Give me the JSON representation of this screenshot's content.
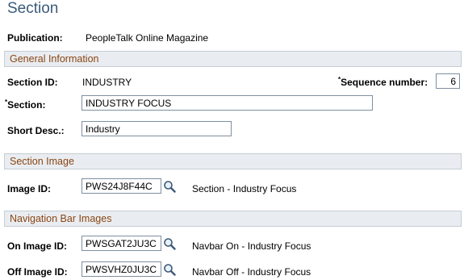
{
  "page": {
    "title": "Section"
  },
  "publication": {
    "label": "Publication:",
    "value": "PeopleTalk Online Magazine"
  },
  "general_info": {
    "header": "General Information",
    "section_id_label": "Section ID:",
    "section_id_value": "INDUSTRY",
    "sequence_label": "Sequence number:",
    "sequence_value": "6",
    "section_label": "Section:",
    "section_value": "INDUSTRY FOCUS",
    "short_desc_label": "Short Desc.:",
    "short_desc_value": "Industry",
    "required_marker": "*"
  },
  "section_image": {
    "header": "Section Image",
    "image_id_label": "Image ID:",
    "image_id_value": "PWS24J8F44C",
    "image_desc": "Section - Industry Focus"
  },
  "nav_bar_images": {
    "header": "Navigation Bar Images",
    "on_label": "On Image ID:",
    "on_value": "PWSGAT2JU3C",
    "on_desc": "Navbar On - Industry Focus",
    "off_label": "Off Image ID:",
    "off_value": "PWSVHZ0JU3C",
    "off_desc": "Navbar Off - Industry Focus"
  },
  "icons": {
    "lookup": "magnifier-lookup-icon"
  },
  "colors": {
    "title": "#3a5a7a",
    "section_header_text": "#8b4513",
    "section_header_bg": "#e9edf1"
  }
}
